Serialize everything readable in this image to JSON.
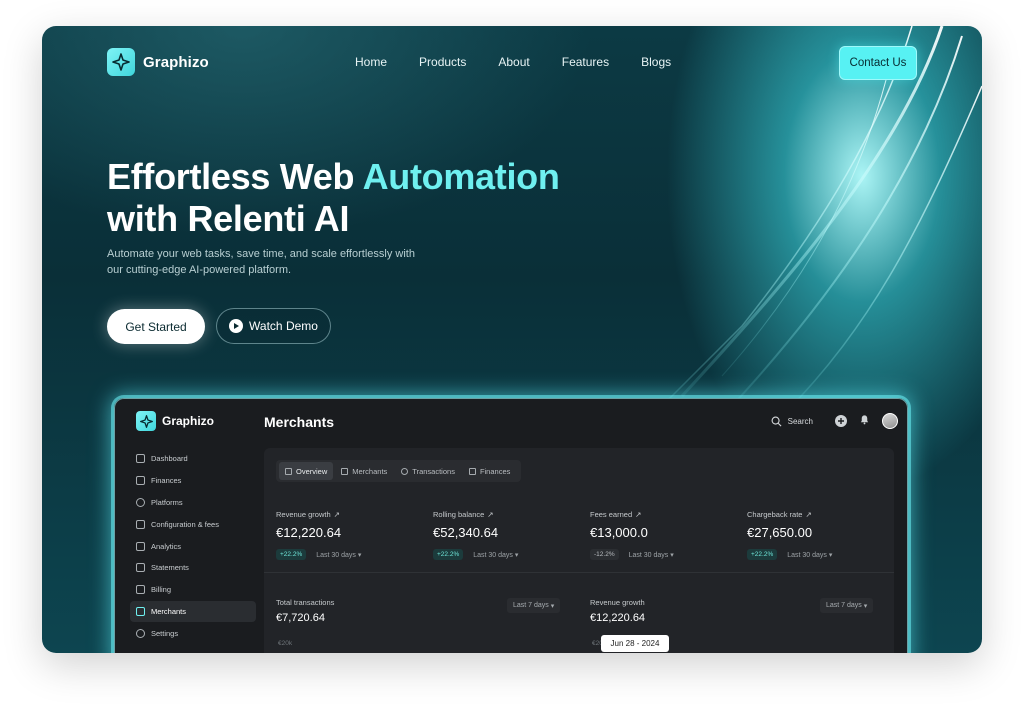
{
  "colors": {
    "accent": "#57f1f3",
    "accent_text": "#6ff0f0",
    "bg_dark": "#0a2f38",
    "dash_bg": "#1a1c1f"
  },
  "nav": {
    "brand": "Graphizo",
    "links": [
      "Home",
      "Products",
      "About",
      "Features",
      "Blogs"
    ],
    "cta": "Contact Us"
  },
  "hero": {
    "title_part1": "Effortless Web ",
    "title_accent": "Automation",
    "title_line2": "with Relenti AI",
    "subtitle": "Automate your web tasks, save time, and scale effortlessly with our cutting-edge AI-powered platform.",
    "primary_cta": "Get Started",
    "secondary_cta": "Watch Demo"
  },
  "dashboard": {
    "brand": "Graphizo",
    "page_title": "Merchants",
    "search_label": "Search",
    "sidebar": [
      {
        "label": "Dashboard",
        "icon": "home-icon"
      },
      {
        "label": "Finances",
        "icon": "wallet-icon"
      },
      {
        "label": "Platforms",
        "icon": "globe-icon"
      },
      {
        "label": "Configuration & fees",
        "icon": "config-icon"
      },
      {
        "label": "Analytics",
        "icon": "analytics-icon"
      },
      {
        "label": "Statements",
        "icon": "document-icon"
      },
      {
        "label": "Billing",
        "icon": "billing-icon"
      },
      {
        "label": "Merchants",
        "icon": "bag-icon",
        "active": true
      },
      {
        "label": "Settings",
        "icon": "gear-icon"
      }
    ],
    "tabs": [
      "Overview",
      "Merchants",
      "Transactions",
      "Finances"
    ],
    "metrics": [
      {
        "label": "Revenue growth",
        "value": "€12,220.64",
        "change": "+22.2%",
        "range": "Last 30 days"
      },
      {
        "label": "Rolling balance",
        "value": "€52,340.64",
        "change": "+22.2%",
        "range": "Last 30 days"
      },
      {
        "label": "Fees earned",
        "value": "€13,000.0",
        "change": "-12.2%",
        "range": "Last 30 days"
      },
      {
        "label": "Chargeback rate",
        "value": "€27,650.00",
        "change": "+22.2%",
        "range": "Last 30 days"
      }
    ],
    "cards": [
      {
        "label": "Total transactions",
        "value": "€7,720.64",
        "range": "Last 7 days",
        "axis": "€20k"
      },
      {
        "label": "Revenue growth",
        "value": "€12,220.64",
        "range": "Last 7 days",
        "axis": "€20k"
      }
    ],
    "tooltip": "Jun 28 - 2024"
  }
}
